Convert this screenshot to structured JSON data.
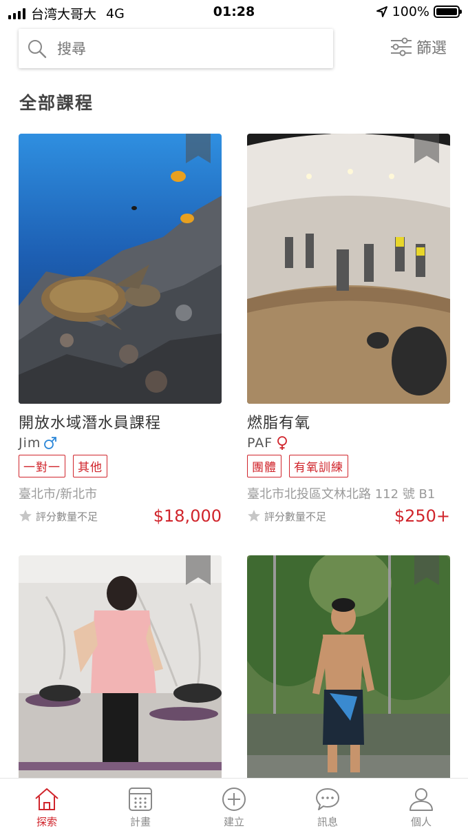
{
  "status_bar": {
    "carrier": "台湾大哥大",
    "network": "4G",
    "time": "01:28",
    "battery": "100%",
    "battery_level": 1.0
  },
  "search": {
    "placeholder": "搜尋"
  },
  "filter": {
    "label": "篩選"
  },
  "section_title": "全部課程",
  "courses": [
    {
      "title": "開放水域潛水員課程",
      "coach": "Jim",
      "gender": "male",
      "tags": [
        "一對一",
        "其他"
      ],
      "location": "臺北市/新北市",
      "rating": "評分數量不足",
      "price": "$18,000"
    },
    {
      "title": "燃脂有氧",
      "coach": "PAF",
      "gender": "female",
      "tags": [
        "團體",
        "有氧訓練"
      ],
      "location": "臺北市北投區文林北路 112 號 B1",
      "rating": "評分數量不足",
      "price": "$250+"
    },
    {},
    {}
  ],
  "tab_bar": {
    "items": [
      {
        "label": "探索",
        "icon": "home-icon",
        "active": true
      },
      {
        "label": "計畫",
        "icon": "calendar-icon",
        "active": false
      },
      {
        "label": "建立",
        "icon": "plus-circle-icon",
        "active": false
      },
      {
        "label": "訊息",
        "icon": "chat-bubble-icon",
        "active": false
      },
      {
        "label": "個人",
        "icon": "person-icon",
        "active": false
      }
    ]
  },
  "colors": {
    "accent": "#d0242b",
    "muted": "#9a9a9a",
    "male": "#2a86d8",
    "female": "#d0242b"
  }
}
